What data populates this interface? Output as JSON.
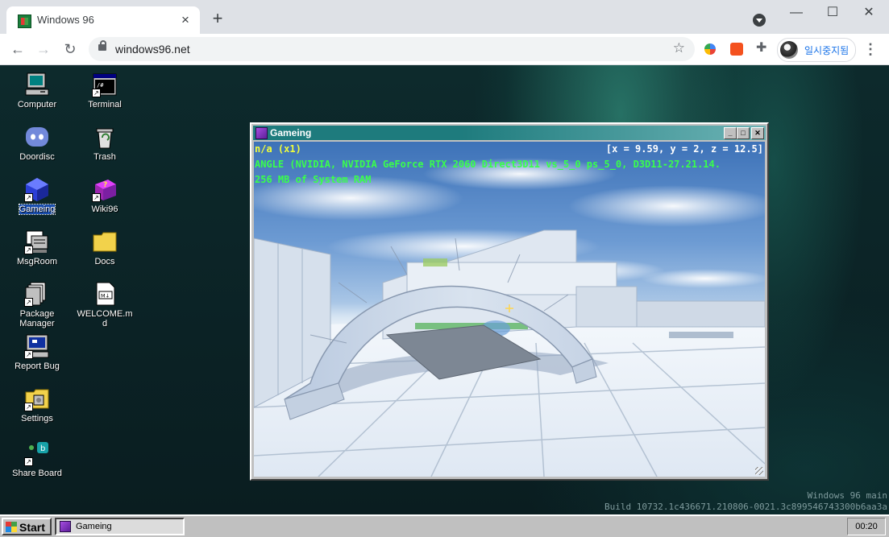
{
  "browser": {
    "tab_title": "Windows 96",
    "new_tab_label": "+",
    "url": "windows96.net",
    "profile_label": "일시중지됨"
  },
  "desktop": {
    "icons": [
      {
        "label": "Computer"
      },
      {
        "label": "Terminal"
      },
      {
        "label": "Doordisc"
      },
      {
        "label": "Trash"
      },
      {
        "label": "Gameing"
      },
      {
        "label": "Wiki96"
      },
      {
        "label": "MsgRoom"
      },
      {
        "label": "Docs"
      },
      {
        "label": "Package Manager"
      },
      {
        "label": "WELCOME.md"
      },
      {
        "label": "Report Bug"
      },
      {
        "label": "Settings"
      },
      {
        "label": "Share Board"
      }
    ],
    "watermark_line1": "Windows 96 main",
    "watermark_line2": "Build 10732.1c436671.210806-0021.3c899546743300b6aa3a"
  },
  "window": {
    "title": "Gameing",
    "hud": {
      "fps": "n/a (x1)",
      "coords": "[x = 9.59, y = 2, z = 12.5]",
      "renderer": "ANGLE (NVIDIA, NVIDIA GeForce RTX 2060 Direct3D11 vs_5_0 ps_5_0, D3D11-27.21.14.",
      "memory": "256 MB of System RAM"
    }
  },
  "taskbar": {
    "start_label": "Start",
    "task_label": "Gameing",
    "clock": "00:20"
  },
  "colors": {
    "titlebar": "#1e7b7d",
    "hud_yellow": "#f2ff3a",
    "hud_green": "#39ff4b",
    "selection": "#1a4fb0"
  }
}
